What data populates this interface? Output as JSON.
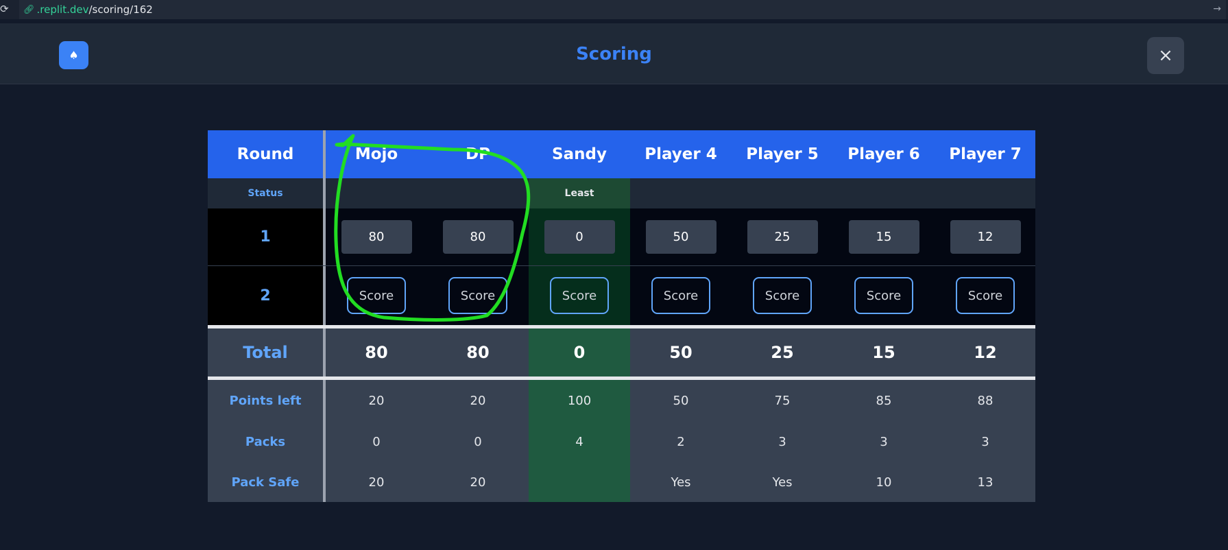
{
  "browser": {
    "url_domain": ".replit.dev",
    "url_path": "/scoring/162"
  },
  "header": {
    "title": "Scoring",
    "logo_icon": "spade-icon",
    "close_icon": "close-icon"
  },
  "table": {
    "round_header": "Round",
    "status_label": "Status",
    "players": [
      "Mojo",
      "DP",
      "Sandy",
      "Player 4",
      "Player 5",
      "Player 6",
      "Player 7"
    ],
    "status": [
      "",
      "",
      "Least",
      "",
      "",
      "",
      ""
    ],
    "rounds": [
      {
        "label": "1",
        "scores": [
          "80",
          "80",
          "0",
          "50",
          "25",
          "15",
          "12"
        ]
      },
      {
        "label": "2",
        "button_label": "Score"
      }
    ],
    "total_label": "Total",
    "totals": [
      "80",
      "80",
      "0",
      "50",
      "25",
      "15",
      "12"
    ],
    "points_left_label": "Points left",
    "points_left": [
      "20",
      "20",
      "100",
      "50",
      "75",
      "85",
      "88"
    ],
    "packs_label": "Packs",
    "packs": [
      "0",
      "0",
      "4",
      "2",
      "3",
      "3",
      "3"
    ],
    "pack_safe_label": "Pack Safe",
    "pack_safe": [
      "20",
      "20",
      "",
      "Yes",
      "Yes",
      "10",
      "13"
    ],
    "highlight_color": "#1f5a40",
    "accent_color": "#2563eb"
  },
  "annotation": {
    "stroke_color": "#22dd22"
  }
}
